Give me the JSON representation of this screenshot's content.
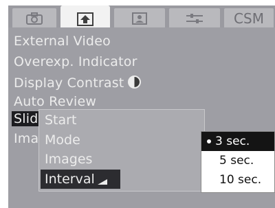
{
  "tabs": [
    {
      "name": "camera-icon"
    },
    {
      "name": "playback-icon"
    },
    {
      "name": "setup-icon"
    },
    {
      "name": "settings-icon"
    },
    {
      "label": "CSM"
    }
  ],
  "menu": {
    "items": [
      "External Video",
      "Overexp. Indicator",
      "Display Contrast",
      "Auto Review",
      "Slid",
      "Ima"
    ]
  },
  "submenu": {
    "items": [
      "Start",
      "Mode",
      "Images",
      "Interval"
    ]
  },
  "options": {
    "items": [
      "3 sec.",
      "5 sec.",
      "10 sec."
    ],
    "selected": "3 sec."
  },
  "colors": {
    "panel": "#9e9ea4",
    "highlight": "#1c1c20",
    "text": "#ececec"
  }
}
